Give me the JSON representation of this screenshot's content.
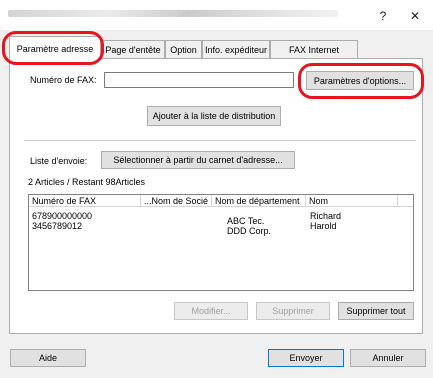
{
  "window": {
    "help_glyph": "?",
    "close_glyph": "✕"
  },
  "tabs": [
    {
      "label": "Paramètre adresse"
    },
    {
      "label": "Page d'entête"
    },
    {
      "label": "Option"
    },
    {
      "label": "Info. expéditeur"
    },
    {
      "label": "FAX Internet"
    }
  ],
  "fax": {
    "label": "Numéro de FAX:",
    "value": "",
    "options_button": "Paramètres d'options..."
  },
  "add_button": "Ajouter à la liste de distribution",
  "send_list": {
    "label": "Liste d'envoie:",
    "select_button": "Sélectionner à partir du carnet d'adresse...",
    "count_text": "2  Articles / Restant  98Articles"
  },
  "table": {
    "columns": [
      "Numéro de FAX",
      "...Nom de Socié",
      "Nom de département",
      "Nom"
    ],
    "rows": [
      {
        "fax": "678900000000",
        "company": "",
        "department": "ABC Tec.",
        "name": "Richard"
      },
      {
        "fax": "3456789012",
        "company": "",
        "department": "DDD Corp.",
        "name": "Harold"
      }
    ]
  },
  "actions": {
    "modify": "Modifier...",
    "delete": "Supprimer",
    "delete_all": "Supprimer tout"
  },
  "footer": {
    "help": "Aide",
    "send": "Envoyer",
    "cancel": "Annuler"
  },
  "colors": {
    "highlight": "#e8141e"
  }
}
